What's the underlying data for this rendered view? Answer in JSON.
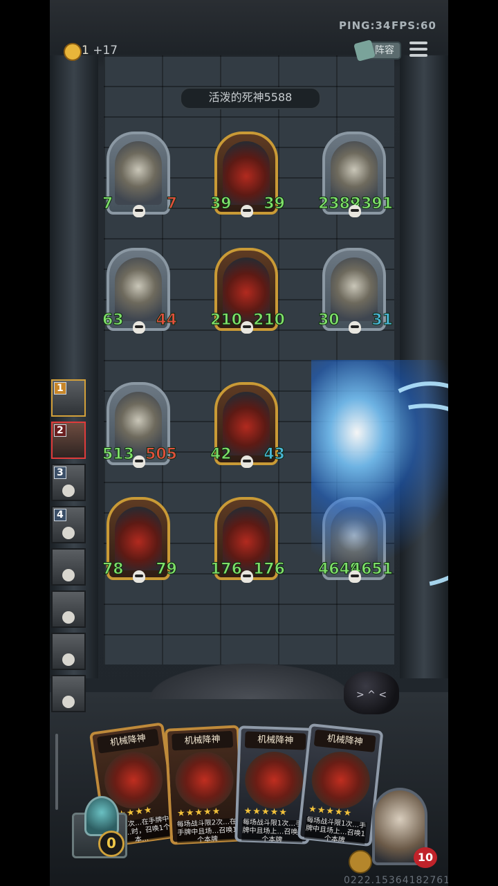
{
  "hud": {
    "ping": "PING:34",
    "fps": "FPS:60",
    "gold": "1",
    "gold_income": "+17",
    "lineup_label": "阵容"
  },
  "opponent": {
    "name": "活泼的死神5588"
  },
  "board": [
    {
      "frame": "silver",
      "attack": "7",
      "health": "7",
      "hp_color": "dmg"
    },
    {
      "frame": "gold",
      "attack": "39",
      "health": "39",
      "hp_color": "normal"
    },
    {
      "frame": "silver",
      "attack": "2389",
      "health": "2391",
      "hp_color": "normal"
    },
    {
      "frame": "silver",
      "attack": "63",
      "health": "44",
      "hp_color": "dmg"
    },
    {
      "frame": "gold",
      "attack": "210",
      "health": "210",
      "hp_color": "normal"
    },
    {
      "frame": "silver",
      "attack": "30",
      "health": "31",
      "hp_color": "blue"
    },
    {
      "frame": "silver",
      "attack": "513",
      "health": "505",
      "hp_color": "dmg"
    },
    {
      "frame": "gold",
      "attack": "42",
      "health": "43",
      "hp_color": "blue"
    },
    {
      "frame": "gold",
      "attack": "78",
      "health": "79",
      "hp_color": "normal"
    },
    {
      "frame": "gold",
      "attack": "176",
      "health": "176",
      "hp_color": "normal"
    },
    {
      "frame": "silver",
      "attack": "4649",
      "health": "4651",
      "hp_color": "normal"
    }
  ],
  "players": [
    {
      "rank": "1",
      "style": "gold"
    },
    {
      "rank": "2",
      "style": "active"
    },
    {
      "rank": "3",
      "style": "normal"
    },
    {
      "rank": "4",
      "style": "normal"
    },
    {
      "rank": "",
      "style": "normal"
    },
    {
      "rank": "",
      "style": "normal"
    },
    {
      "rank": "",
      "style": "normal"
    },
    {
      "rank": "",
      "style": "normal"
    }
  ],
  "hand": [
    {
      "title": "机械降神",
      "desc": "…限2次…在手牌中且场…时，召唤1个本…",
      "frame": "gold"
    },
    {
      "title": "机械降神",
      "desc": "每场战斗限2次…在手牌中且场…召唤1个本牌",
      "frame": "gold"
    },
    {
      "title": "机械降神",
      "desc": "每场战斗限1次…手牌中且场上…召唤1个本牌",
      "frame": "silver"
    },
    {
      "title": "机械降神",
      "desc": "每场战斗限1次…手牌中且场上…召唤1个本牌",
      "frame": "silver"
    }
  ],
  "refresh_count": "0",
  "hero_health": "10",
  "seed": "0222.15364182761",
  "colors": {
    "gold_frame": "#c99a36",
    "silver_frame": "#8b98a3",
    "stat_green": "#7fe06a",
    "stat_red": "#e0503d",
    "stat_blue": "#4ab7d9"
  }
}
